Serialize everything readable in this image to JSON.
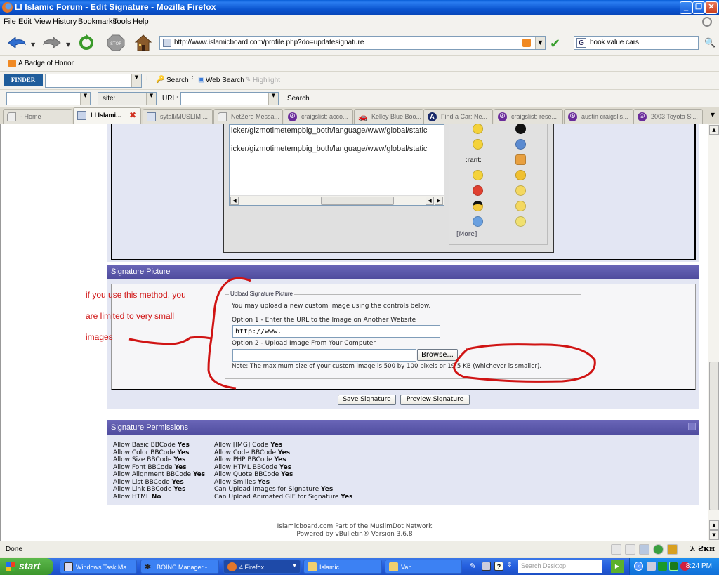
{
  "window": {
    "title": "LI Islamic Forum - Edit Signature - Mozilla Firefox",
    "minimize_label": "_",
    "restore_label": "❐",
    "close_label": "✕"
  },
  "menu": [
    "File",
    "Edit",
    "View",
    "History",
    "Bookmarks",
    "Tools",
    "Help"
  ],
  "nav": {
    "url": "http://www.islamicboard.com/profile.php?do=updatesignature",
    "search_query": "book value cars",
    "search_engine_glyph": "G"
  },
  "bookmarks": [
    {
      "label": "A Badge of Honor",
      "icon": "rss-icon"
    }
  ],
  "finder_toolbar": {
    "logo": "FINDER",
    "search_label": "Search",
    "web_search_label": "Web Search",
    "highlight_label": "Highlight"
  },
  "search_toolbar": {
    "site_value": "site:",
    "url_label": "URL:",
    "search_label": "Search"
  },
  "tabs": [
    {
      "label": "- Home",
      "icon": "page-icon",
      "active": false
    },
    {
      "label": "LI Islami...",
      "icon": "page-icon",
      "active": true
    },
    {
      "label": "sytall/MUSLIM ...",
      "icon": "photo-icon",
      "active": false
    },
    {
      "label": "NetZero Messa...",
      "icon": "page-icon",
      "active": false
    },
    {
      "label": "craigslist: acco...",
      "icon": "peace-icon",
      "active": false
    },
    {
      "label": "Kelley Blue Boo...",
      "icon": "car-icon",
      "active": false
    },
    {
      "label": "Find a Car: Ne...",
      "icon": "a-icon",
      "active": false
    },
    {
      "label": "craigslist: rese...",
      "icon": "peace-icon",
      "active": false
    },
    {
      "label": "austin craigslis...",
      "icon": "peace-icon",
      "active": false
    },
    {
      "label": "2003 Toyota Si...",
      "icon": "peace-icon",
      "active": false
    }
  ],
  "signature_editor": {
    "lines": [
      "icker/gizmotimetempbig_both/language/www/global/static",
      "icker/gizmotimetempbig_both/language/www/global/static"
    ],
    "smilie_text": ":rant:",
    "more_link": "[More]"
  },
  "signature_picture": {
    "header": "Signature Picture",
    "fieldset_legend": "Upload Signature Picture",
    "intro": "You may upload a new custom image using the controls below.",
    "option1_label": "Option 1 - Enter the URL to the Image on Another Website",
    "option1_value": "http://www.",
    "option2_label": "Option 2 - Upload Image From Your Computer",
    "option2_value": "",
    "browse_label": "Browse...",
    "note": "Note: The maximum size of your custom image is 500 by 100 pixels or 19.5 KB (whichever is smaller)."
  },
  "annotation": {
    "lines": [
      "if you use this method, you",
      "are limited to very small",
      "images"
    ],
    "color": "#d01414"
  },
  "actions": {
    "save_label": "Save Signature",
    "preview_label": "Preview Signature"
  },
  "permissions": {
    "header": "Signature Permissions",
    "left": [
      {
        "label": "Allow Basic BBCode",
        "value": "Yes"
      },
      {
        "label": "Allow Color BBCode",
        "value": "Yes"
      },
      {
        "label": "Allow Size BBCode",
        "value": "Yes"
      },
      {
        "label": "Allow Font BBCode",
        "value": "Yes"
      },
      {
        "label": "Allow Alignment BBCode",
        "value": "Yes"
      },
      {
        "label": "Allow List BBCode",
        "value": "Yes"
      },
      {
        "label": "Allow Link BBCode",
        "value": "Yes"
      },
      {
        "label": "Allow HTML",
        "value": "No"
      }
    ],
    "right": [
      {
        "label": "Allow [IMG] Code",
        "value": "Yes"
      },
      {
        "label": "Allow Code BBCode",
        "value": "Yes"
      },
      {
        "label": "Allow PHP BBCode",
        "value": "Yes"
      },
      {
        "label": "Allow HTML BBCode",
        "value": "Yes"
      },
      {
        "label": "Allow Quote BBCode",
        "value": "Yes"
      },
      {
        "label": "Allow Smilies",
        "value": "Yes"
      },
      {
        "label": "Can Upload Images for Signature",
        "value": "Yes"
      },
      {
        "label": "Can Upload Animated GIF for Signature",
        "value": "Yes"
      }
    ]
  },
  "footer": {
    "line1": "Islamicboard.com Part of the MuslimDot Network",
    "line2": "Powered by vBulletin® Version 3.6.8"
  },
  "statusbar": {
    "status": "Done",
    "extension_label": "λ Ƨкн"
  },
  "taskbar": {
    "start_label": "start",
    "tasks": [
      {
        "label": "Windows Task Ma...",
        "active": false
      },
      {
        "label": "BOINC Manager - ...",
        "active": false
      },
      {
        "label": "4 Firefox",
        "active": true
      },
      {
        "label": "Islamic",
        "active": false
      },
      {
        "label": "Van",
        "active": false
      }
    ],
    "desktop_search_placeholder": "Search Desktop",
    "clock": "8:24 PM"
  },
  "colors": {
    "category_header": "#5452a8",
    "panel_bg": "#e3e6f3",
    "annotation_red": "#d01414"
  }
}
